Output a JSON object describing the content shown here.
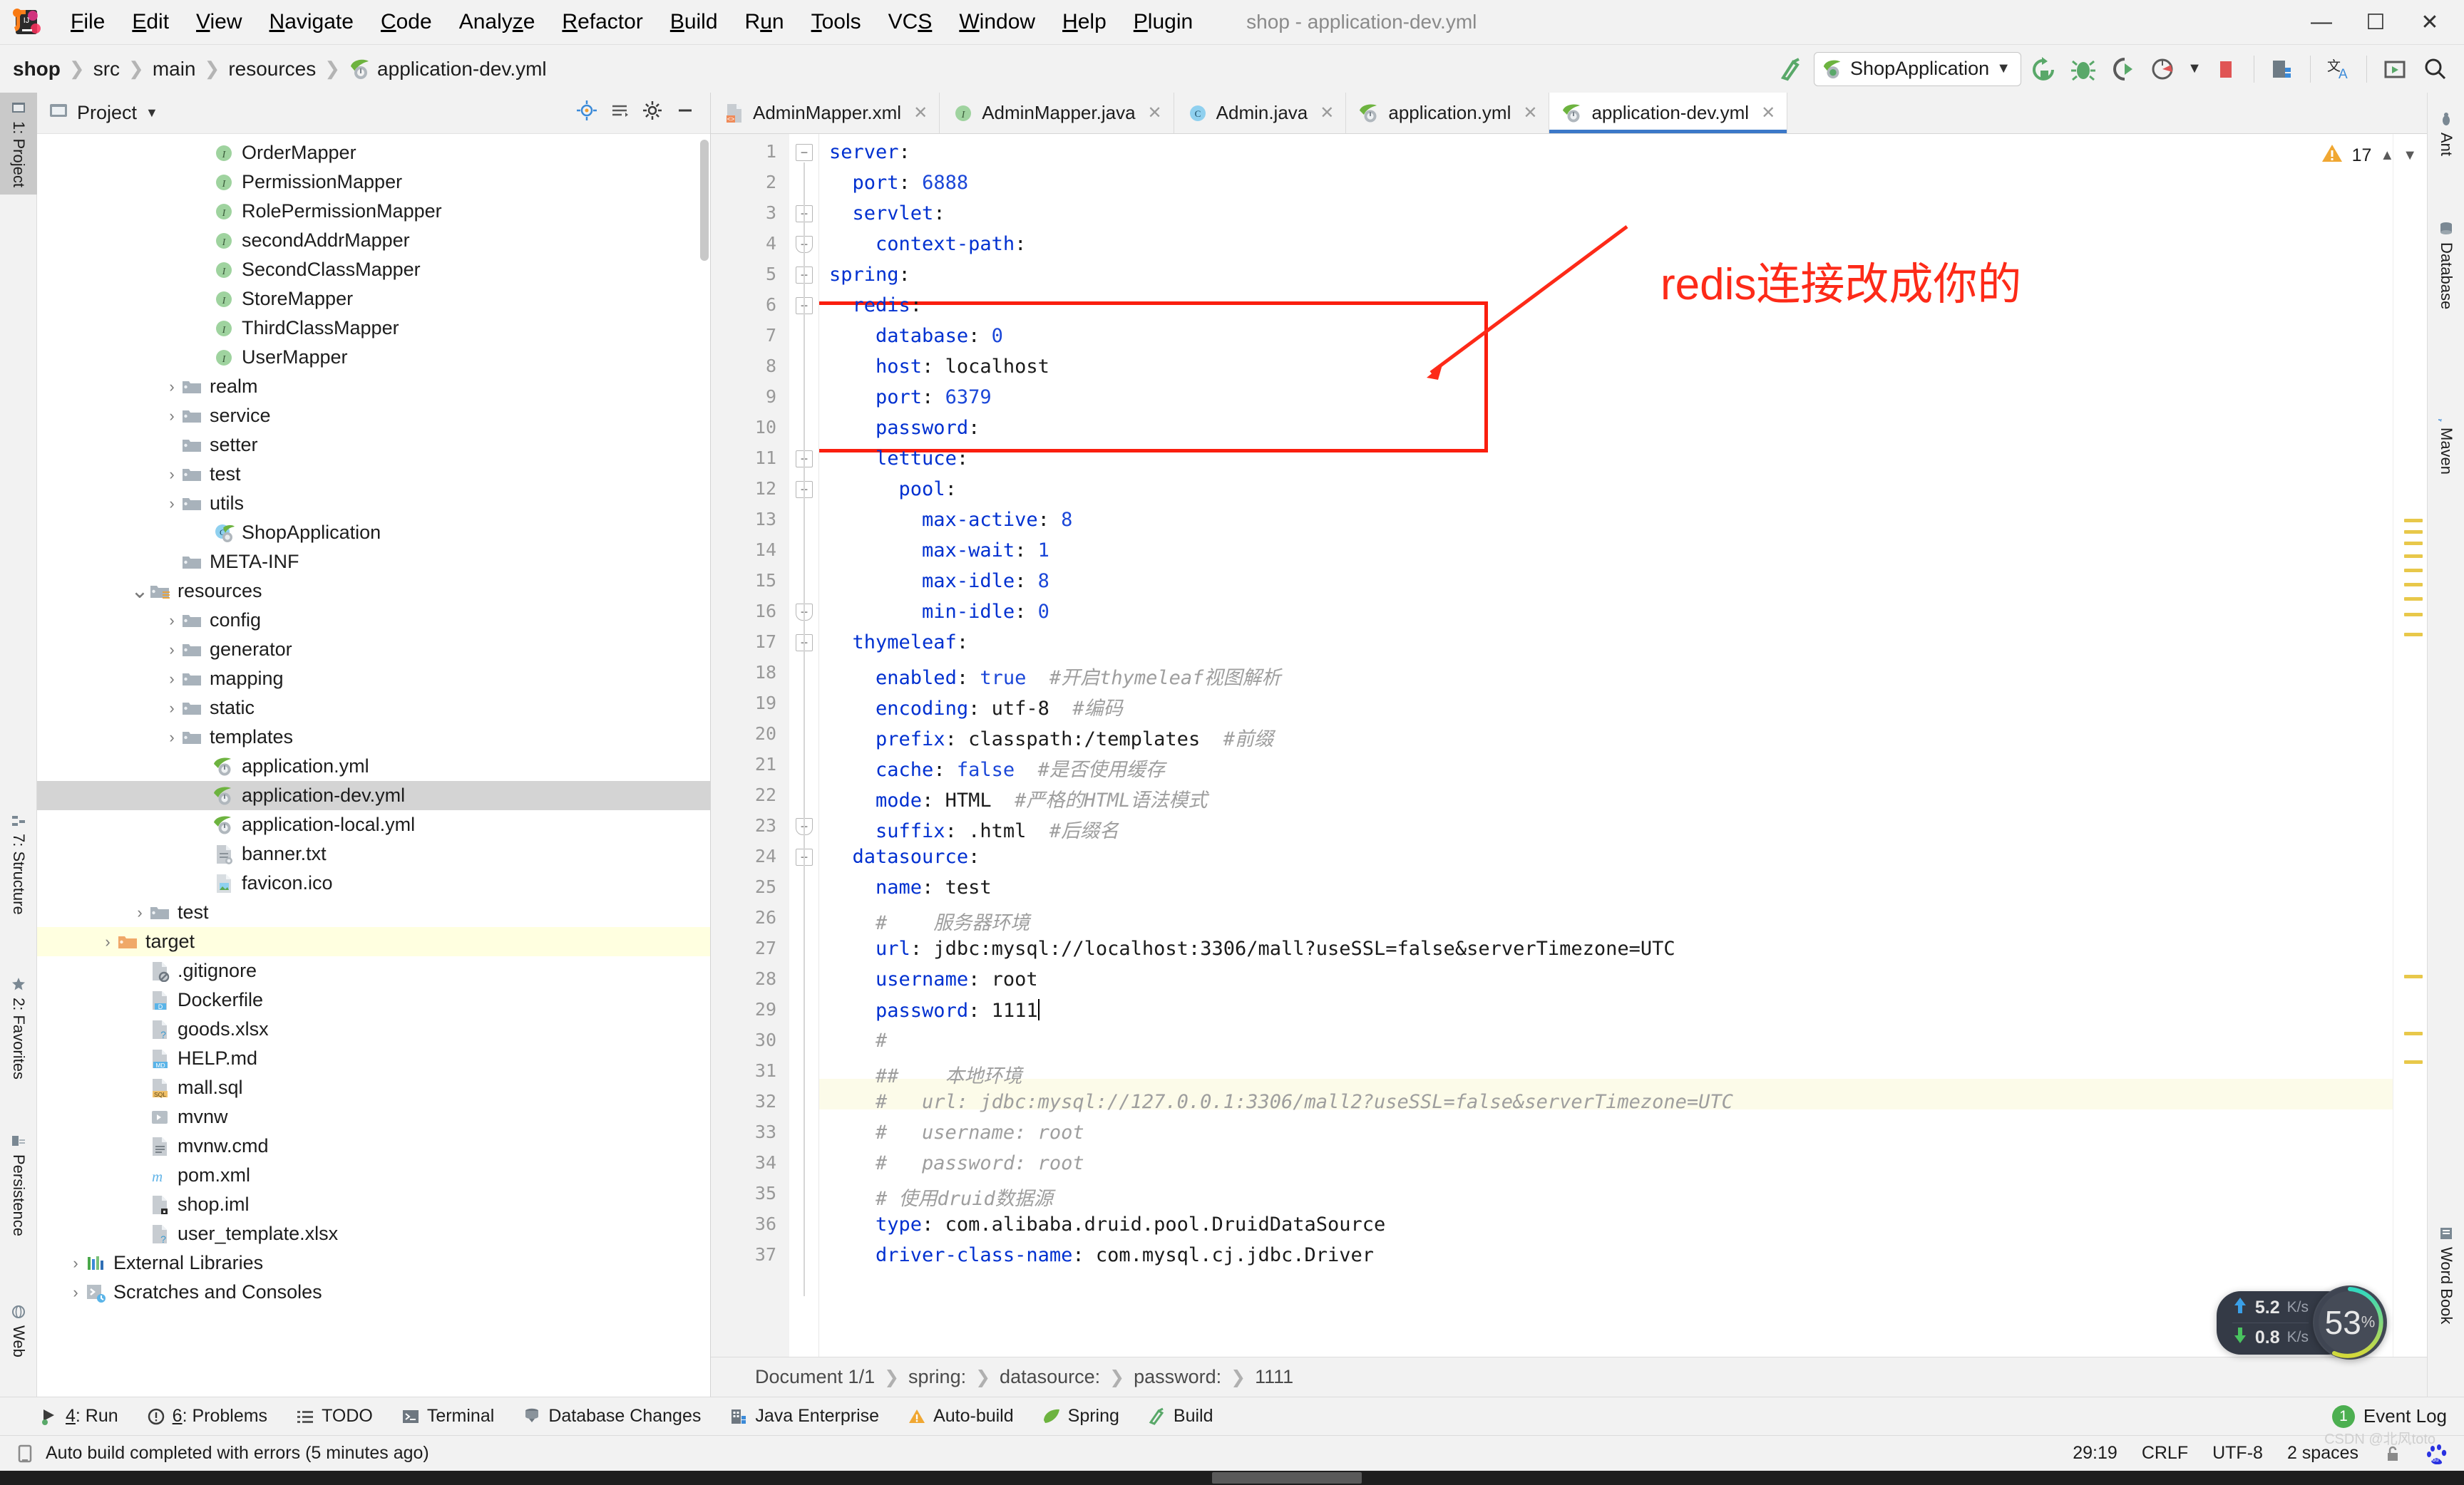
{
  "window": {
    "title": "shop - application-dev.yml"
  },
  "menu": {
    "items": [
      "File",
      "Edit",
      "View",
      "Navigate",
      "Code",
      "Analyze",
      "Refactor",
      "Build",
      "Run",
      "Tools",
      "VCS",
      "Window",
      "Help",
      "Plugin"
    ],
    "controls": [
      "minimize",
      "maximize",
      "close"
    ]
  },
  "navbar": {
    "breadcrumbs": [
      "shop",
      "src",
      "main",
      "resources",
      "application-dev.yml"
    ],
    "run_config": "ShopApplication",
    "icons": [
      "hammer-icon",
      "spring-leaf-icon",
      "chevron-down-icon",
      "rerun-icon",
      "debug-icon",
      "run-with-coverage-icon",
      "profiler-icon",
      "stop-icon",
      "project-structure-icon",
      "translate-icon",
      "preview-icon",
      "search-icon"
    ]
  },
  "left_rail": [
    {
      "label": "1: Project",
      "icon": "project-icon",
      "active": true
    },
    {
      "label": "7: Structure",
      "icon": "structure-icon",
      "active": false
    },
    {
      "label": "2: Favorites",
      "icon": "star-icon",
      "active": false
    },
    {
      "label": "Persistence",
      "icon": "persistence-icon",
      "active": false
    },
    {
      "label": "Web",
      "icon": "web-icon",
      "active": false
    }
  ],
  "right_rail": [
    {
      "label": "Ant",
      "icon": "ant-icon"
    },
    {
      "label": "Database",
      "icon": "database-icon"
    },
    {
      "label": "Maven",
      "icon": "maven-icon"
    },
    {
      "label": "Word Book",
      "icon": "word-book-icon"
    }
  ],
  "project_panel": {
    "title": "Project",
    "actions": [
      "locate-icon",
      "collapse-all-icon",
      "settings-icon",
      "hide-icon"
    ],
    "tree": [
      {
        "label": "OrderMapper",
        "icon": "interface-icon",
        "indent": 5,
        "arrow": "",
        "state": ""
      },
      {
        "label": "PermissionMapper",
        "icon": "interface-icon",
        "indent": 5,
        "arrow": "",
        "state": ""
      },
      {
        "label": "RolePermissionMapper",
        "icon": "interface-icon",
        "indent": 5,
        "arrow": "",
        "state": ""
      },
      {
        "label": "secondAddrMapper",
        "icon": "interface-icon",
        "indent": 5,
        "arrow": "",
        "state": ""
      },
      {
        "label": "SecondClassMapper",
        "icon": "interface-icon",
        "indent": 5,
        "arrow": "",
        "state": ""
      },
      {
        "label": "StoreMapper",
        "icon": "interface-icon",
        "indent": 5,
        "arrow": "",
        "state": ""
      },
      {
        "label": "ThirdClassMapper",
        "icon": "interface-icon",
        "indent": 5,
        "arrow": "",
        "state": ""
      },
      {
        "label": "UserMapper",
        "icon": "interface-icon",
        "indent": 5,
        "arrow": "",
        "state": ""
      },
      {
        "label": "realm",
        "icon": "folder-icon",
        "indent": 4,
        "arrow": "collapsed",
        "state": ""
      },
      {
        "label": "service",
        "icon": "folder-icon",
        "indent": 4,
        "arrow": "collapsed",
        "state": ""
      },
      {
        "label": "setter",
        "icon": "folder-icon",
        "indent": 4,
        "arrow": "",
        "state": ""
      },
      {
        "label": "test",
        "icon": "folder-icon",
        "indent": 4,
        "arrow": "collapsed",
        "state": ""
      },
      {
        "label": "utils",
        "icon": "folder-icon",
        "indent": 4,
        "arrow": "collapsed",
        "state": ""
      },
      {
        "label": "ShopApplication",
        "icon": "spring-class-icon",
        "indent": 5,
        "arrow": "",
        "state": ""
      },
      {
        "label": "META-INF",
        "icon": "folder-icon",
        "indent": 4,
        "arrow": "",
        "state": ""
      },
      {
        "label": "resources",
        "icon": "resources-folder-icon",
        "indent": 3,
        "arrow": "expanded",
        "state": ""
      },
      {
        "label": "config",
        "icon": "folder-icon",
        "indent": 4,
        "arrow": "collapsed",
        "state": ""
      },
      {
        "label": "generator",
        "icon": "folder-icon",
        "indent": 4,
        "arrow": "collapsed",
        "state": ""
      },
      {
        "label": "mapping",
        "icon": "folder-icon",
        "indent": 4,
        "arrow": "collapsed",
        "state": ""
      },
      {
        "label": "static",
        "icon": "folder-icon",
        "indent": 4,
        "arrow": "collapsed",
        "state": ""
      },
      {
        "label": "templates",
        "icon": "folder-icon",
        "indent": 4,
        "arrow": "collapsed",
        "state": ""
      },
      {
        "label": "application.yml",
        "icon": "spring-yaml-icon",
        "indent": 5,
        "arrow": "",
        "state": ""
      },
      {
        "label": "application-dev.yml",
        "icon": "spring-yaml-icon",
        "indent": 5,
        "arrow": "",
        "state": "selected"
      },
      {
        "label": "application-local.yml",
        "icon": "spring-yaml-icon",
        "indent": 5,
        "arrow": "",
        "state": ""
      },
      {
        "label": "banner.txt",
        "icon": "text-file-icon",
        "indent": 5,
        "arrow": "",
        "state": ""
      },
      {
        "label": "favicon.ico",
        "icon": "image-file-icon",
        "indent": 5,
        "arrow": "",
        "state": ""
      },
      {
        "label": "test",
        "icon": "folder-icon",
        "indent": 3,
        "arrow": "collapsed",
        "state": ""
      },
      {
        "label": "target",
        "icon": "target-folder-icon",
        "indent": 2,
        "arrow": "collapsed",
        "state": "marked"
      },
      {
        "label": ".gitignore",
        "icon": "gitignore-file-icon",
        "indent": 3,
        "arrow": "",
        "state": ""
      },
      {
        "label": "Dockerfile",
        "icon": "docker-file-icon",
        "indent": 3,
        "arrow": "",
        "state": ""
      },
      {
        "label": "goods.xlsx",
        "icon": "unknown-file-icon",
        "indent": 3,
        "arrow": "",
        "state": ""
      },
      {
        "label": "HELP.md",
        "icon": "markdown-file-icon",
        "indent": 3,
        "arrow": "",
        "state": ""
      },
      {
        "label": "mall.sql",
        "icon": "sql-file-icon",
        "indent": 3,
        "arrow": "",
        "state": ""
      },
      {
        "label": "mvnw",
        "icon": "script-file-icon",
        "indent": 3,
        "arrow": "",
        "state": ""
      },
      {
        "label": "mvnw.cmd",
        "icon": "cmd-file-icon",
        "indent": 3,
        "arrow": "",
        "state": ""
      },
      {
        "label": "pom.xml",
        "icon": "maven-file-icon",
        "indent": 3,
        "arrow": "",
        "state": ""
      },
      {
        "label": "shop.iml",
        "icon": "iml-file-icon",
        "indent": 3,
        "arrow": "",
        "state": ""
      },
      {
        "label": "user_template.xlsx",
        "icon": "unknown-file-icon",
        "indent": 3,
        "arrow": "",
        "state": ""
      },
      {
        "label": "External Libraries",
        "icon": "libraries-icon",
        "indent": 1,
        "arrow": "collapsed",
        "state": ""
      },
      {
        "label": "Scratches and Consoles",
        "icon": "scratches-icon",
        "indent": 1,
        "arrow": "collapsed",
        "state": ""
      }
    ]
  },
  "tabs": [
    {
      "label": "AdminMapper.xml",
      "icon": "xml-file-icon",
      "active": false
    },
    {
      "label": "AdminMapper.java",
      "icon": "interface-icon",
      "active": false
    },
    {
      "label": "Admin.java",
      "icon": "class-icon",
      "active": false
    },
    {
      "label": "application.yml",
      "icon": "spring-yaml-icon",
      "active": false
    },
    {
      "label": "application-dev.yml",
      "icon": "spring-yaml-icon",
      "active": true
    }
  ],
  "editor": {
    "warning_count": "17",
    "warning_icon": "warning-triangle-icon",
    "lines": [
      {
        "n": "1",
        "parts": [
          [
            "k",
            "server"
          ],
          [
            "v",
            ":"
          ]
        ]
      },
      {
        "n": "2",
        "parts": [
          [
            "v",
            "  "
          ],
          [
            "k",
            "port"
          ],
          [
            "v",
            ": "
          ],
          [
            "n",
            "6888"
          ]
        ]
      },
      {
        "n": "3",
        "parts": [
          [
            "v",
            "  "
          ],
          [
            "k",
            "servlet"
          ],
          [
            "v",
            ":"
          ]
        ]
      },
      {
        "n": "4",
        "parts": [
          [
            "v",
            "    "
          ],
          [
            "k",
            "context-path"
          ],
          [
            "v",
            ":"
          ]
        ]
      },
      {
        "n": "5",
        "parts": [
          [
            "k",
            "spring"
          ],
          [
            "v",
            ":"
          ]
        ]
      },
      {
        "n": "6",
        "parts": [
          [
            "v",
            "  "
          ],
          [
            "k",
            "redis"
          ],
          [
            "v",
            ":"
          ]
        ]
      },
      {
        "n": "7",
        "parts": [
          [
            "v",
            "    "
          ],
          [
            "k",
            "database"
          ],
          [
            "v",
            ": "
          ],
          [
            "n",
            "0"
          ]
        ]
      },
      {
        "n": "8",
        "parts": [
          [
            "v",
            "    "
          ],
          [
            "k",
            "host"
          ],
          [
            "v",
            ": localhost"
          ]
        ]
      },
      {
        "n": "9",
        "parts": [
          [
            "v",
            "    "
          ],
          [
            "k",
            "port"
          ],
          [
            "v",
            ": "
          ],
          [
            "n",
            "6379"
          ]
        ]
      },
      {
        "n": "10",
        "parts": [
          [
            "v",
            "    "
          ],
          [
            "k",
            "password"
          ],
          [
            "v",
            ":"
          ]
        ]
      },
      {
        "n": "11",
        "parts": [
          [
            "v",
            "    "
          ],
          [
            "k",
            "lettuce"
          ],
          [
            "v",
            ":"
          ]
        ]
      },
      {
        "n": "12",
        "parts": [
          [
            "v",
            "      "
          ],
          [
            "k",
            "pool"
          ],
          [
            "v",
            ":"
          ]
        ]
      },
      {
        "n": "13",
        "parts": [
          [
            "v",
            "        "
          ],
          [
            "k",
            "max-active"
          ],
          [
            "v",
            ": "
          ],
          [
            "n",
            "8"
          ]
        ]
      },
      {
        "n": "14",
        "parts": [
          [
            "v",
            "        "
          ],
          [
            "k",
            "max-wait"
          ],
          [
            "v",
            ": "
          ],
          [
            "n",
            "1"
          ]
        ]
      },
      {
        "n": "15",
        "parts": [
          [
            "v",
            "        "
          ],
          [
            "k",
            "max-idle"
          ],
          [
            "v",
            ": "
          ],
          [
            "n",
            "8"
          ]
        ]
      },
      {
        "n": "16",
        "parts": [
          [
            "v",
            "        "
          ],
          [
            "k",
            "min-idle"
          ],
          [
            "v",
            ": "
          ],
          [
            "n",
            "0"
          ]
        ]
      },
      {
        "n": "17",
        "parts": [
          [
            "v",
            "  "
          ],
          [
            "k",
            "thymeleaf"
          ],
          [
            "v",
            ":"
          ]
        ]
      },
      {
        "n": "18",
        "parts": [
          [
            "v",
            "    "
          ],
          [
            "k",
            "enabled"
          ],
          [
            "v",
            ": "
          ],
          [
            "n",
            "true"
          ],
          [
            "cm",
            "  #开启thymeleaf视图解析"
          ]
        ]
      },
      {
        "n": "19",
        "parts": [
          [
            "v",
            "    "
          ],
          [
            "k",
            "encoding"
          ],
          [
            "v",
            ": utf-8"
          ],
          [
            "cm",
            "  #编码"
          ]
        ]
      },
      {
        "n": "20",
        "parts": [
          [
            "v",
            "    "
          ],
          [
            "k",
            "prefix"
          ],
          [
            "v",
            ": classpath:/templates"
          ],
          [
            "cm",
            "  #前缀"
          ]
        ]
      },
      {
        "n": "21",
        "parts": [
          [
            "v",
            "    "
          ],
          [
            "k",
            "cache"
          ],
          [
            "v",
            ": "
          ],
          [
            "n",
            "false"
          ],
          [
            "cm",
            "  #是否使用缓存"
          ]
        ]
      },
      {
        "n": "22",
        "parts": [
          [
            "v",
            "    "
          ],
          [
            "k",
            "mode"
          ],
          [
            "v",
            ": HTML"
          ],
          [
            "cm",
            "  #严格的HTML语法模式"
          ]
        ]
      },
      {
        "n": "23",
        "parts": [
          [
            "v",
            "    "
          ],
          [
            "k",
            "suffix"
          ],
          [
            "v",
            ": .html"
          ],
          [
            "cm",
            "  #后缀名"
          ]
        ]
      },
      {
        "n": "24",
        "parts": [
          [
            "v",
            "  "
          ],
          [
            "k",
            "datasource"
          ],
          [
            "v",
            ":"
          ]
        ]
      },
      {
        "n": "25",
        "parts": [
          [
            "v",
            "    "
          ],
          [
            "k",
            "name"
          ],
          [
            "v",
            ": test"
          ]
        ]
      },
      {
        "n": "26",
        "parts": [
          [
            "cm",
            "    #    服务器环境"
          ]
        ]
      },
      {
        "n": "27",
        "parts": [
          [
            "v",
            "    "
          ],
          [
            "k",
            "url"
          ],
          [
            "v",
            ": jdbc:mysql://localhost:3306/mall?useSSL=false&serverTimezone=UTC"
          ]
        ]
      },
      {
        "n": "28",
        "parts": [
          [
            "v",
            "    "
          ],
          [
            "k",
            "username"
          ],
          [
            "v",
            ": root"
          ]
        ]
      },
      {
        "n": "29",
        "parts": [
          [
            "v",
            "    "
          ],
          [
            "k",
            "password"
          ],
          [
            "v",
            ": 1111"
          ],
          [
            "caret",
            ""
          ]
        ]
      },
      {
        "n": "30",
        "parts": [
          [
            "cm",
            "    #"
          ]
        ]
      },
      {
        "n": "31",
        "parts": [
          [
            "cm",
            "    ##    本地环境"
          ]
        ]
      },
      {
        "n": "32",
        "parts": [
          [
            "cm",
            "    #   url: jdbc:mysql://127.0.0.1:3306/mall2?useSSL=false&serverTimezone=UTC"
          ]
        ]
      },
      {
        "n": "33",
        "parts": [
          [
            "cm",
            "    #   username: root"
          ]
        ]
      },
      {
        "n": "34",
        "parts": [
          [
            "cm",
            "    #   password: root"
          ]
        ]
      },
      {
        "n": "35",
        "parts": [
          [
            "cm",
            "    # 使用druid数据源"
          ]
        ]
      },
      {
        "n": "36",
        "parts": [
          [
            "v",
            "    "
          ],
          [
            "k",
            "type"
          ],
          [
            "v",
            ": com.alibaba.druid.pool.DruidDataSource"
          ]
        ]
      },
      {
        "n": "37",
        "parts": [
          [
            "v",
            "    "
          ],
          [
            "k",
            "driver-class-name"
          ],
          [
            "v",
            ": com.mysql.cj.jdbc.Driver"
          ]
        ]
      }
    ],
    "annotation": {
      "text": "redis连接改成你的",
      "color": "#fd2a18"
    },
    "breadcrumb": [
      "Document 1/1",
      "spring:",
      "datasource:",
      "password:",
      "1111"
    ]
  },
  "tool_window_bar": {
    "items": [
      {
        "label": "4: Run",
        "icon": "run-icon",
        "underline": "4"
      },
      {
        "label": "6: Problems",
        "icon": "problems-icon",
        "underline": "6"
      },
      {
        "label": "TODO",
        "icon": "todo-icon",
        "underline": ""
      },
      {
        "label": "Terminal",
        "icon": "terminal-icon",
        "underline": ""
      },
      {
        "label": "Database Changes",
        "icon": "database-changes-icon",
        "underline": ""
      },
      {
        "label": "Java Enterprise",
        "icon": "java-enterprise-icon",
        "underline": ""
      },
      {
        "label": "Auto-build",
        "icon": "auto-build-warning-icon",
        "underline": ""
      },
      {
        "label": "Spring",
        "icon": "spring-leaf-icon",
        "underline": ""
      },
      {
        "label": "Build",
        "icon": "build-icon",
        "underline": ""
      }
    ],
    "event_log": {
      "label": "Event Log",
      "badge": "1"
    }
  },
  "status_bar": {
    "message": "Auto build completed with errors (5 minutes ago)",
    "message_icon": "build-status-icon",
    "caret_position": "29:19",
    "line_separator": "CRLF",
    "encoding": "UTF-8",
    "indent": "2 spaces",
    "lock_icon": "unlocked-icon",
    "extra_icon": "baidu-icon"
  },
  "perf_widget": {
    "upload": "5.2",
    "upload_unit": "K/s",
    "download": "0.8",
    "download_unit": "K/s",
    "cpu": "53",
    "cpu_unit": "%"
  },
  "watermark": "CSDN @北风toto"
}
